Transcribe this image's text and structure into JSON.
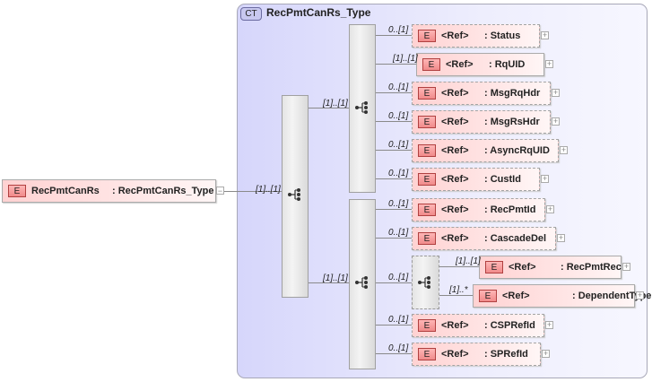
{
  "root": {
    "badge": "E",
    "name": "RecPmtCanRs",
    "type": ": RecPmtCanRs_Type",
    "toggle": "−",
    "cardinality": "[1]..[1]"
  },
  "complex_type": {
    "badge": "CT",
    "title": "RecPmtCanRs_Type"
  },
  "outer_sequence": {
    "cardinalities": [
      "[1]..[1]",
      "[1]..[1]"
    ]
  },
  "sequence1": {
    "children": [
      {
        "badge": "E",
        "ref": "<Ref>",
        "name": ": Status",
        "cardinality": "0..[1]",
        "optional": true,
        "expand": "+"
      },
      {
        "badge": "E",
        "ref": "<Ref>",
        "name": ": RqUID",
        "cardinality": "[1]..[1]",
        "optional": false,
        "expand": "+"
      },
      {
        "badge": "E",
        "ref": "<Ref>",
        "name": ": MsgRqHdr",
        "cardinality": "0..[1]",
        "optional": true,
        "expand": "+"
      },
      {
        "badge": "E",
        "ref": "<Ref>",
        "name": ": MsgRsHdr",
        "cardinality": "0..[1]",
        "optional": true,
        "expand": "+"
      },
      {
        "badge": "E",
        "ref": "<Ref>",
        "name": ": AsyncRqUID",
        "cardinality": "0..[1]",
        "optional": true,
        "expand": "+"
      },
      {
        "badge": "E",
        "ref": "<Ref>",
        "name": ": CustId",
        "cardinality": "0..[1]",
        "optional": true,
        "expand": "+"
      }
    ]
  },
  "sequence2": {
    "children": [
      {
        "badge": "E",
        "ref": "<Ref>",
        "name": ": RecPmtId",
        "cardinality": "0..[1]",
        "optional": true,
        "expand": "+"
      },
      {
        "badge": "E",
        "ref": "<Ref>",
        "name": ": CascadeDel",
        "cardinality": "0..[1]",
        "optional": true,
        "expand": "+"
      },
      {
        "badge": "E",
        "ref": "<Ref>",
        "name": ": CSPRefId",
        "cardinality": "0..[1]",
        "optional": true,
        "expand": "+"
      },
      {
        "badge": "E",
        "ref": "<Ref>",
        "name": ": SPRefId",
        "cardinality": "0..[1]",
        "optional": true,
        "expand": "+"
      }
    ],
    "choice": {
      "cardinality": "0..[1]",
      "children": [
        {
          "badge": "E",
          "ref": "<Ref>",
          "name": ": RecPmtRec",
          "cardinality": "[1]..[1]",
          "optional": false,
          "expand": "+"
        },
        {
          "badge": "E",
          "ref": "<Ref>",
          "name": ": DependentType",
          "cardinality": "[1]..*",
          "optional": false,
          "expand": "+"
        }
      ]
    }
  }
}
